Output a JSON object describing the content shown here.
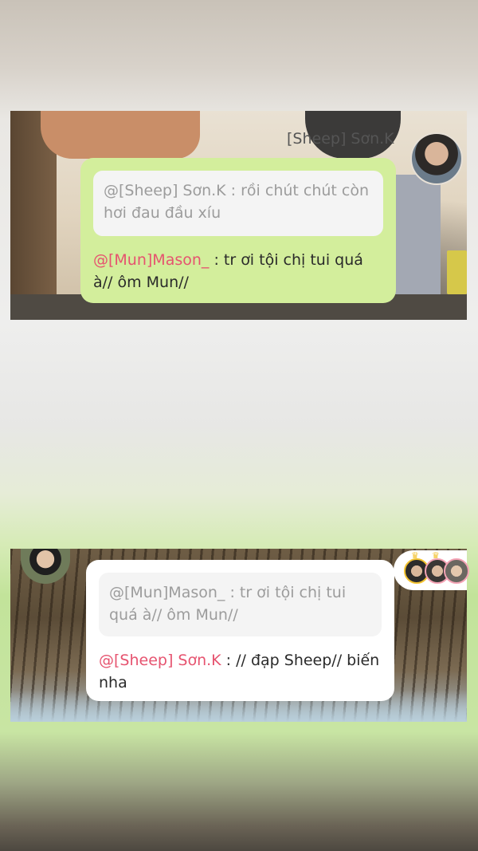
{
  "card_top": {
    "watermark": "[Sheep] Sơn.K",
    "avatar_icon": "profile-photo-icon",
    "quote": "@[Sheep] Sơn.K : rồi chút chút còn hơi đau đầu xíu",
    "reply_mention": "@[Mun]Mason_",
    "reply_text": " : tr ơi tội chị tui quá à// ôm Mun//"
  },
  "card_bottom": {
    "avatar_icon": "profile-photo-icon",
    "group_avatars_icon": "group-avatars-icon",
    "quote": "@[Mun]Mason_ : tr ơi tội chị tui quá à// ôm Mun//",
    "reply_mention": "@[Sheep] Sơn.K",
    "reply_text": " : // đạp Sheep// biến nha"
  },
  "colors": {
    "bubble_green": "#d3ee9c",
    "bubble_white": "#ffffff",
    "quote_bg": "#f4f4f4",
    "mention": "#e6536f"
  }
}
